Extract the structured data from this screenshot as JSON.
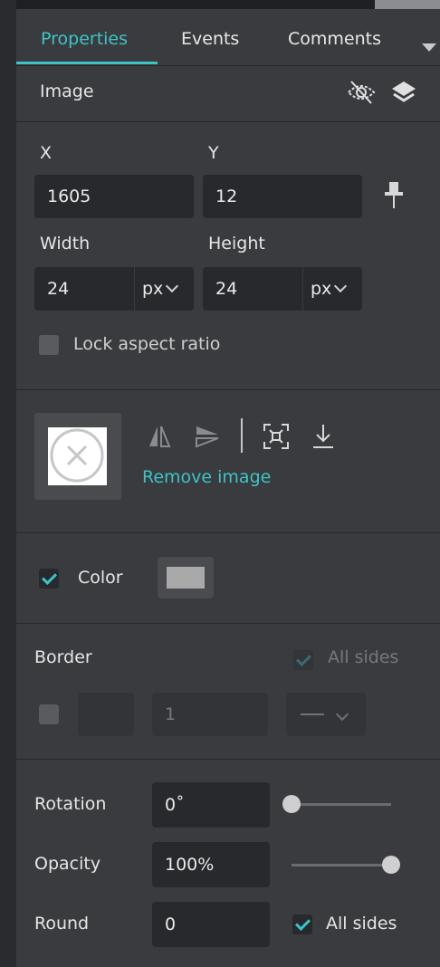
{
  "tabs": [
    {
      "label": "Properties"
    },
    {
      "label": "Events"
    },
    {
      "label": "Comments"
    }
  ],
  "section_title": "Image",
  "position": {
    "x_label": "X",
    "x_value": "1605",
    "y_label": "Y",
    "y_value": "12"
  },
  "size": {
    "width_label": "Width",
    "width_value": "24",
    "width_unit": "px",
    "height_label": "Height",
    "height_value": "24",
    "height_unit": "px"
  },
  "lock_aspect": {
    "label": "Lock aspect ratio",
    "checked": false
  },
  "image": {
    "remove_label": "Remove image"
  },
  "color": {
    "label": "Color",
    "checked": true,
    "swatch": "#a9a9a9"
  },
  "border": {
    "label": "Border",
    "all_sides_label": "All sides",
    "width_value": "1",
    "enabled": false
  },
  "rotation": {
    "label": "Rotation",
    "value": "0˚",
    "slider_level": 0
  },
  "opacity": {
    "label": "Opacity",
    "value": "100%",
    "slider_level": 1
  },
  "round": {
    "label": "Round",
    "value": "0",
    "all_sides_label": "All sides",
    "all_sides_checked": true
  },
  "colors": {
    "accent": "#3cc4c8",
    "panel": "#3a3b3e",
    "field": "#28292c"
  }
}
